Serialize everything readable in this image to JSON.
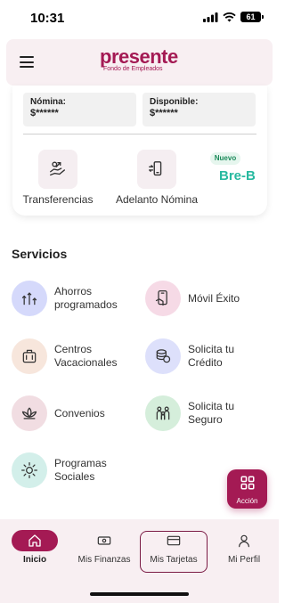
{
  "status_bar": {
    "time": "10:31",
    "battery": "61"
  },
  "header": {
    "logo_text": "presente",
    "logo_subtext": "Fondo de Empleados"
  },
  "account": {
    "nomina_label": "Nómina:",
    "nomina_value": "$******",
    "disponible_label": "Disponible:",
    "disponible_value": "$******",
    "quick_actions": [
      {
        "label": "Transferencias",
        "icon": "hand-money-icon"
      },
      {
        "label": "Adelanto Nómina",
        "icon": "phone-transfer-icon"
      }
    ],
    "new_badge": "Nuevo",
    "breb_label": "Bre-B"
  },
  "services": {
    "title": "Servicios",
    "items": [
      {
        "label": "Ahorros programados",
        "icon": "savings-chart-icon",
        "color": "#d5d9fb"
      },
      {
        "label": "Móvil Éxito",
        "icon": "phone-hand-icon",
        "color": "#f6dae6"
      },
      {
        "label": "Centros Vacacionales",
        "icon": "luggage-icon",
        "color": "#f7e6dc"
      },
      {
        "label": "Solicita tu Crédito",
        "icon": "credit-coins-icon",
        "color": "#dde0fb"
      },
      {
        "label": "Convenios",
        "icon": "lotus-icon",
        "color": "#f1dde2"
      },
      {
        "label": "Solicita tu Seguro",
        "icon": "family-icon",
        "color": "#d5eedb"
      },
      {
        "label": "Programas Sociales",
        "icon": "sun-icon",
        "color": "#d3efea"
      }
    ]
  },
  "fab": {
    "label": "Acción",
    "icon": "grid-icon"
  },
  "bottom_nav": [
    {
      "label": "Inicio",
      "icon": "home-icon",
      "active": true
    },
    {
      "label": "Mis Finanzas",
      "icon": "cash-icon",
      "active": false
    },
    {
      "label": "Mis Tarjetas",
      "icon": "card-icon",
      "active": false
    },
    {
      "label": "Mi Perfil",
      "icon": "person-icon",
      "active": false
    }
  ],
  "colors": {
    "brand": "#a41a54",
    "breb": "#27b9a0"
  }
}
